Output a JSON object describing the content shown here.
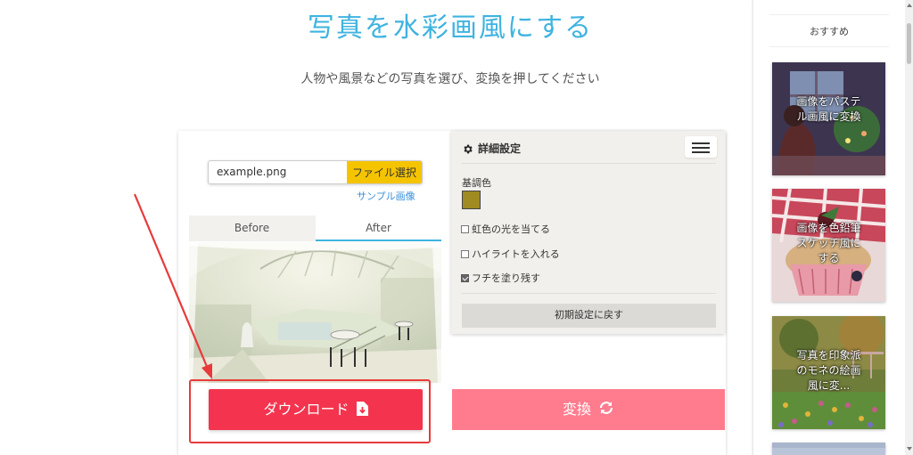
{
  "header": {
    "title": "写真を水彩画風にする",
    "subtitle": "人物や風景などの写真を選び、変換を押してください"
  },
  "upload": {
    "file_name": "example.png",
    "file_button": "ファイル選択",
    "sample_link": "サンプル画像"
  },
  "preview": {
    "tabs": [
      {
        "label": "Before"
      },
      {
        "label": "After"
      }
    ],
    "active_tab": "After"
  },
  "settings": {
    "title": "詳細設定",
    "base_color_label": "基調色",
    "base_color": "#a08a22",
    "options": [
      {
        "label": "虹色の光を当てる",
        "checked": false
      },
      {
        "label": "ハイライトを入れる",
        "checked": false
      },
      {
        "label": "フチを塗り残す",
        "checked": true
      }
    ],
    "reset_button": "初期設定に戻す"
  },
  "actions": {
    "download_label": "ダウンロード",
    "convert_label": "変換"
  },
  "sidebar": {
    "heading": "おすすめ",
    "items": [
      {
        "label": "画像をパステル画風に変換"
      },
      {
        "label": "画像を色鉛筆スケッチ風にする"
      },
      {
        "label": "写真を印象派のモネの絵画風に変..."
      }
    ]
  },
  "colors": {
    "accent": "#3fb3e0",
    "download": "#f4344e",
    "convert": "#ff7c8e",
    "file_button": "#f5c400",
    "annotation": "#e83a3a"
  }
}
